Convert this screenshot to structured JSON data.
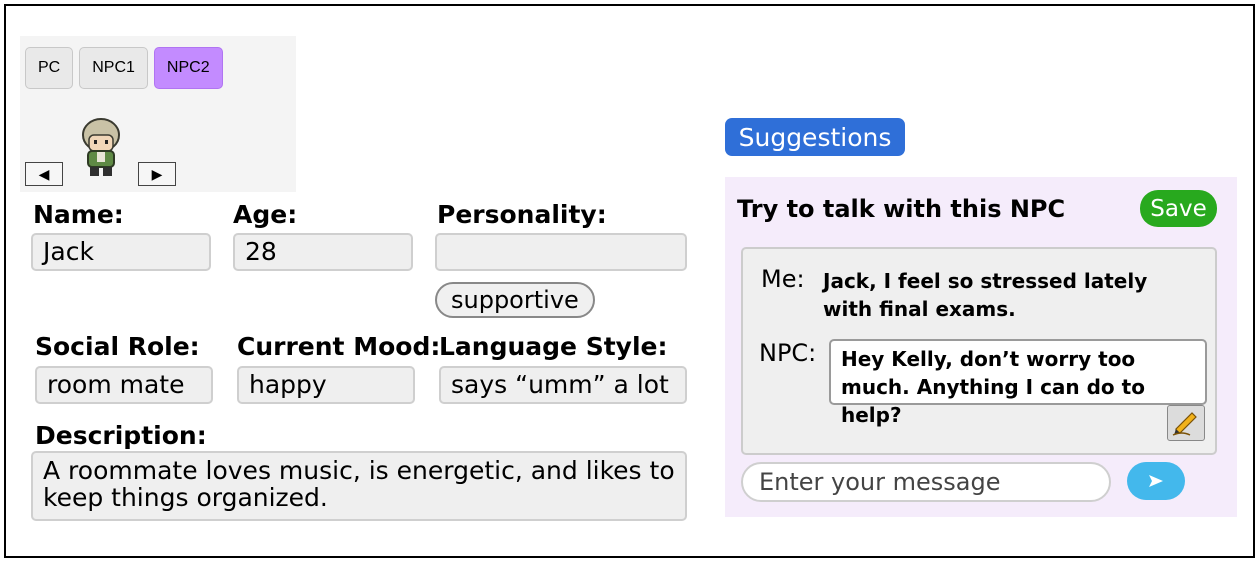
{
  "tabs": [
    "PC",
    "NPC1",
    "NPC2"
  ],
  "active_tab": "NPC2",
  "character": {
    "name_label": "Name:",
    "name_value": "Jack",
    "age_label": "Age:",
    "age_value": "28",
    "personality_label": "Personality:",
    "personality_value": "",
    "personality_tag": "supportive",
    "social_role_label": "Social Role:",
    "social_role_value": "room mate",
    "mood_label": "Current Mood:",
    "mood_value": "happy",
    "language_label": "Language Style:",
    "language_value": "says “umm” a lot",
    "description_label": "Description:",
    "description_value": "A roommate loves music, is energetic, and likes to keep things organized."
  },
  "suggestions_label": "Suggestions",
  "chat": {
    "title": "Try to talk with this NPC",
    "save_label": "Save",
    "me_label": "Me:",
    "me_message": "Jack, I feel so stressed lately with final exams.",
    "npc_label": "NPC:",
    "npc_message": "Hey Kelly, don’t worry too much. Anything I can do to help?",
    "input_placeholder": "Enter your message"
  },
  "colors": {
    "active_tab": "#c38bff",
    "suggestions": "#2f6fd8",
    "save": "#28a91e",
    "send": "#43b8ec",
    "chat_panel": "#f5ecfb"
  },
  "icons": [
    "left-arrow-icon",
    "right-arrow-icon",
    "character-sprite",
    "pencil-edit-icon",
    "send-icon"
  ]
}
